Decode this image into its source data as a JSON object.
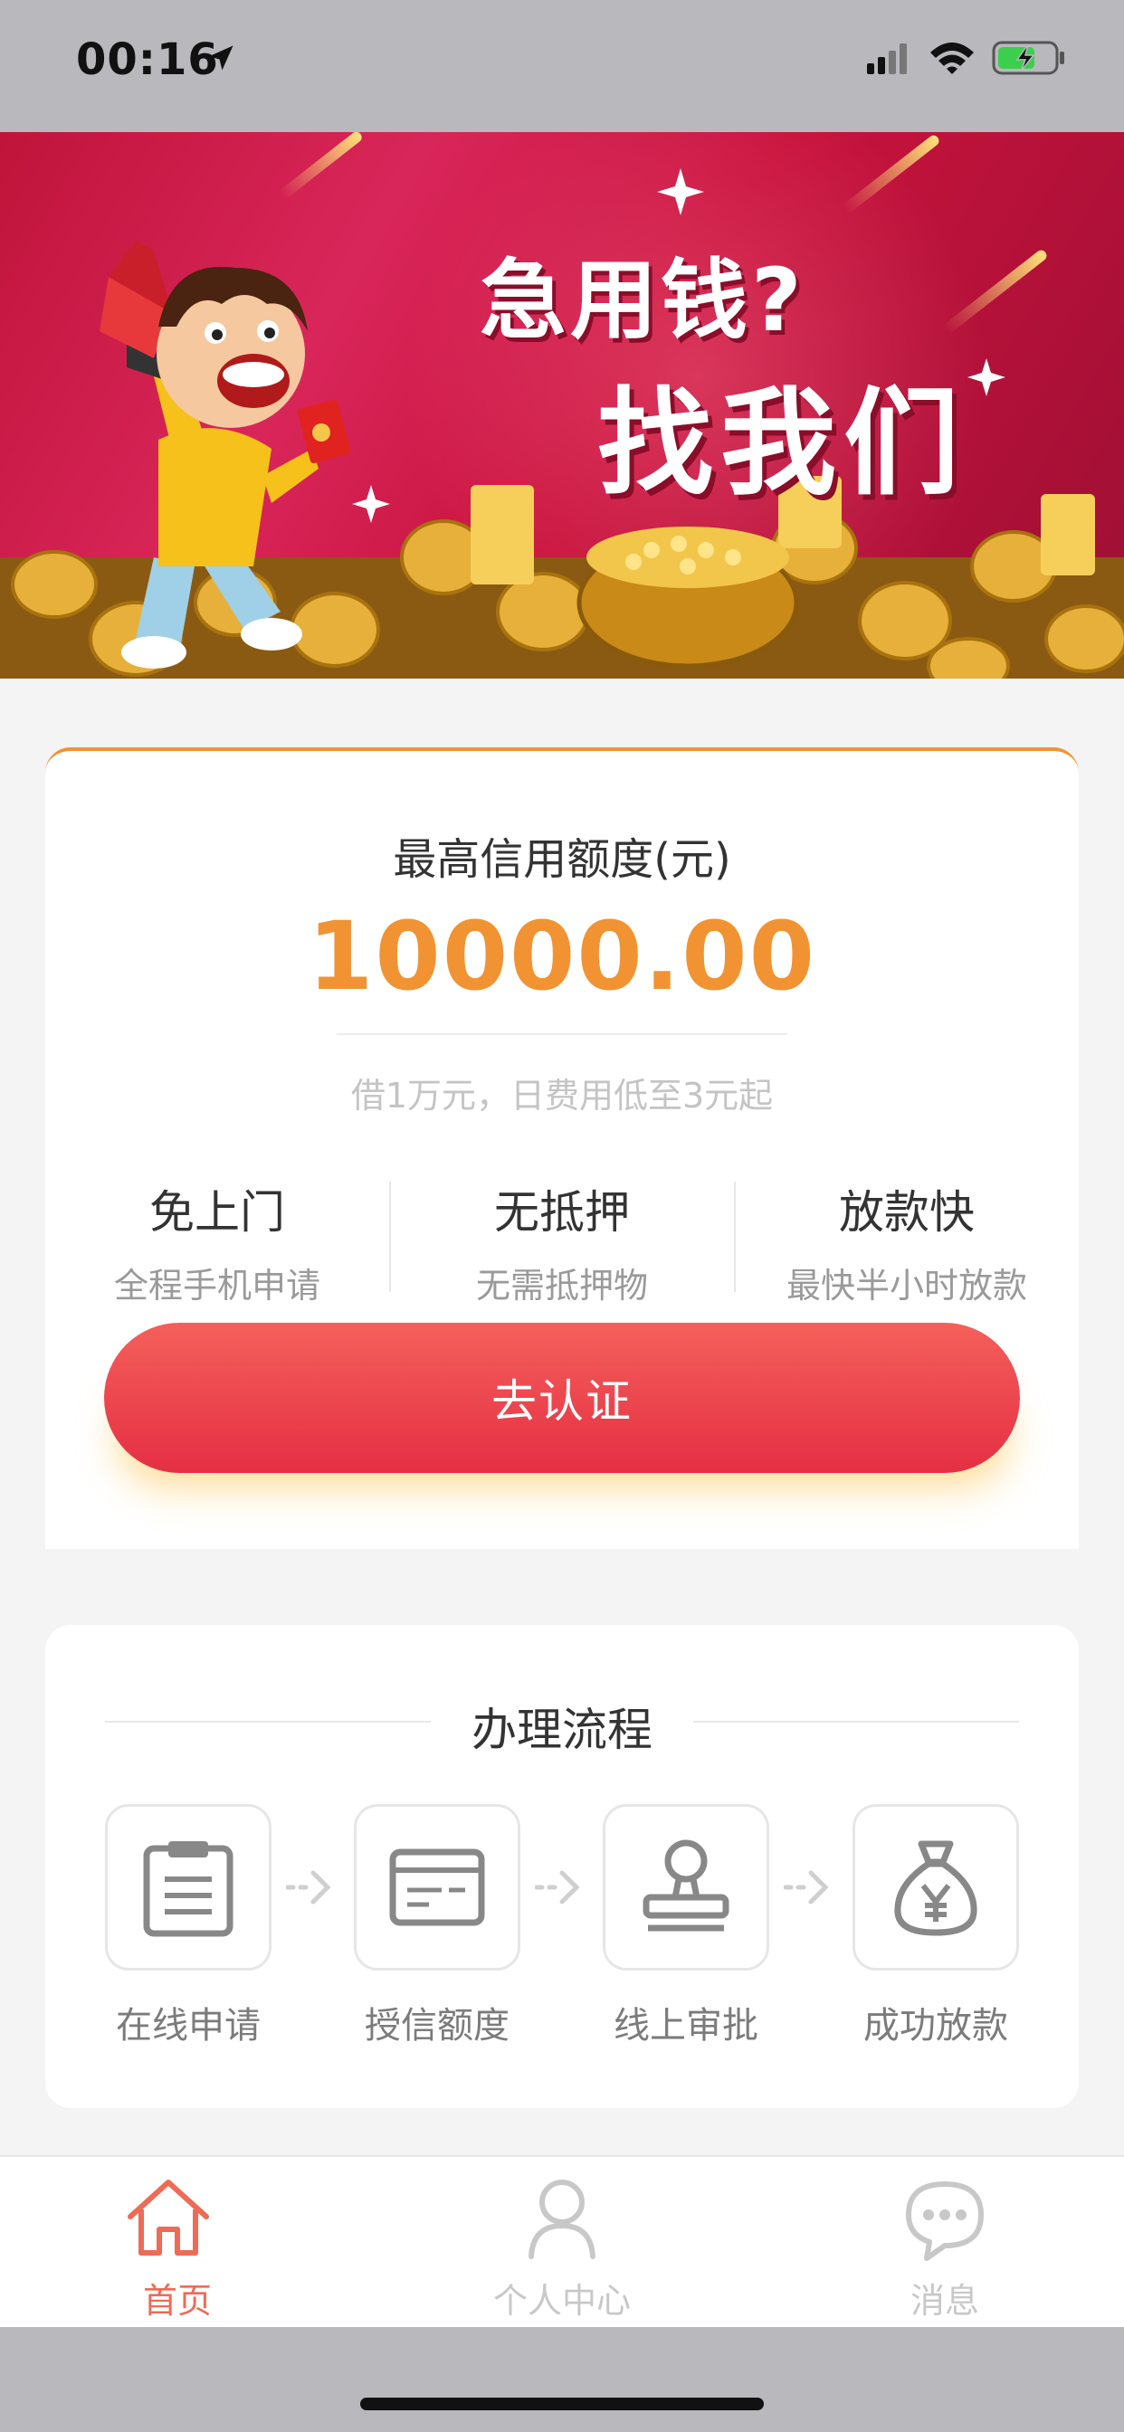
{
  "status_bar": {
    "time": "00:16",
    "icons": [
      "location-arrow-icon",
      "cellular-signal-icon",
      "wifi-icon",
      "battery-charging-icon"
    ]
  },
  "banner": {
    "title_line1": "急用钱?",
    "title_line2": "找我们"
  },
  "credit": {
    "label": "最高信用额度(元)",
    "amount": "10000.00",
    "note": "借1万元，日费用低至3元起",
    "features": [
      {
        "title": "免上门",
        "desc": "全程手机申请"
      },
      {
        "title": "无抵押",
        "desc": "无需抵押物"
      },
      {
        "title": "放款快",
        "desc": "最快半小时放款"
      }
    ],
    "cta_label": "去认证"
  },
  "process": {
    "title": "办理流程",
    "steps": [
      {
        "label": "在线申请",
        "icon": "clipboard-icon"
      },
      {
        "label": "授信额度",
        "icon": "card-icon"
      },
      {
        "label": "线上审批",
        "icon": "stamp-icon"
      },
      {
        "label": "成功放款",
        "icon": "money-bag-icon"
      }
    ]
  },
  "tab_bar": {
    "tabs": [
      {
        "label": "首页",
        "icon": "home-icon",
        "active": true
      },
      {
        "label": "个人中心",
        "icon": "user-icon",
        "active": false
      },
      {
        "label": "消息",
        "icon": "chat-bubble-icon",
        "active": false
      }
    ]
  },
  "colors": {
    "accent_orange": "#f19332",
    "cta_red": "#e52f44",
    "active_tab": "#ee6b55",
    "inactive_tab": "#c8c8c8"
  }
}
